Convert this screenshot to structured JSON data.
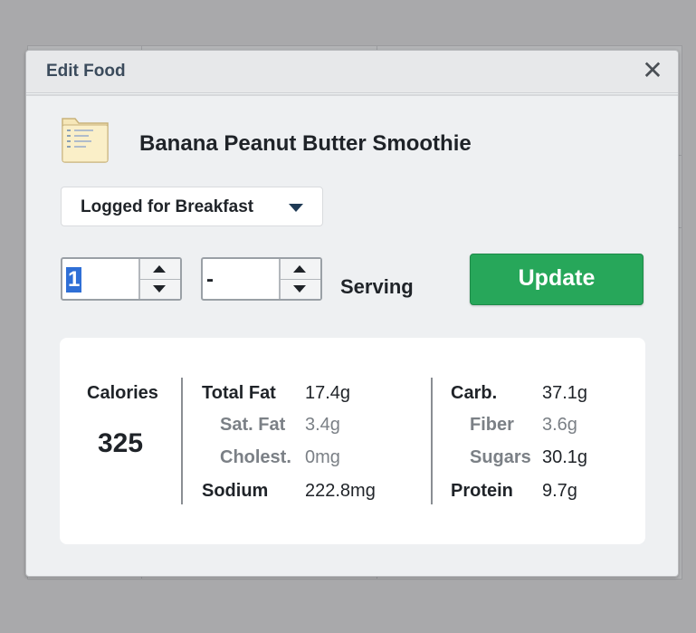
{
  "dialog": {
    "title": "Edit Food",
    "close_symbol": "✕"
  },
  "food": {
    "name": "Banana Peanut Butter Smoothie",
    "icon": "recipe-card-icon"
  },
  "meal_select": {
    "value": "Logged for Breakfast"
  },
  "quantity": {
    "whole": "1",
    "fraction": "-",
    "unit": "Serving"
  },
  "update_button": {
    "label": "Update",
    "color": "#27a75a"
  },
  "nutrition": {
    "calories_label": "Calories",
    "calories_value": "325",
    "left_column": [
      {
        "label": "Total Fat",
        "value": "17.4g",
        "style": "main"
      },
      {
        "label": "Sat. Fat",
        "value": "3.4g",
        "style": "sub"
      },
      {
        "label": "Cholest.",
        "value": "0mg",
        "style": "sub"
      },
      {
        "label": "Sodium",
        "value": "222.8mg",
        "style": "main"
      }
    ],
    "right_column": [
      {
        "label": "Carb.",
        "value": "37.1g",
        "style": "main"
      },
      {
        "label": "Fiber",
        "value": "3.6g",
        "style": "sub"
      },
      {
        "label": "Sugars",
        "value": "30.1g",
        "style": "sub"
      },
      {
        "label": "Protein",
        "value": "9.7g",
        "style": "main"
      }
    ]
  }
}
